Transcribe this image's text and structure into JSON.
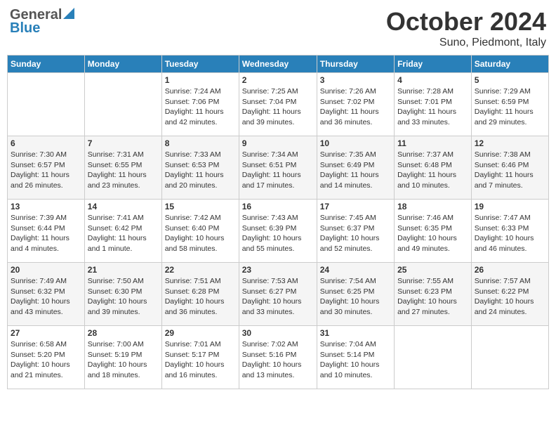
{
  "header": {
    "logo_general": "General",
    "logo_blue": "Blue",
    "title": "October 2024",
    "location": "Suno, Piedmont, Italy"
  },
  "weekdays": [
    "Sunday",
    "Monday",
    "Tuesday",
    "Wednesday",
    "Thursday",
    "Friday",
    "Saturday"
  ],
  "weeks": [
    [
      {
        "day": "",
        "sunrise": "",
        "sunset": "",
        "daylight": ""
      },
      {
        "day": "",
        "sunrise": "",
        "sunset": "",
        "daylight": ""
      },
      {
        "day": "1",
        "sunrise": "Sunrise: 7:24 AM",
        "sunset": "Sunset: 7:06 PM",
        "daylight": "Daylight: 11 hours and 42 minutes."
      },
      {
        "day": "2",
        "sunrise": "Sunrise: 7:25 AM",
        "sunset": "Sunset: 7:04 PM",
        "daylight": "Daylight: 11 hours and 39 minutes."
      },
      {
        "day": "3",
        "sunrise": "Sunrise: 7:26 AM",
        "sunset": "Sunset: 7:02 PM",
        "daylight": "Daylight: 11 hours and 36 minutes."
      },
      {
        "day": "4",
        "sunrise": "Sunrise: 7:28 AM",
        "sunset": "Sunset: 7:01 PM",
        "daylight": "Daylight: 11 hours and 33 minutes."
      },
      {
        "day": "5",
        "sunrise": "Sunrise: 7:29 AM",
        "sunset": "Sunset: 6:59 PM",
        "daylight": "Daylight: 11 hours and 29 minutes."
      }
    ],
    [
      {
        "day": "6",
        "sunrise": "Sunrise: 7:30 AM",
        "sunset": "Sunset: 6:57 PM",
        "daylight": "Daylight: 11 hours and 26 minutes."
      },
      {
        "day": "7",
        "sunrise": "Sunrise: 7:31 AM",
        "sunset": "Sunset: 6:55 PM",
        "daylight": "Daylight: 11 hours and 23 minutes."
      },
      {
        "day": "8",
        "sunrise": "Sunrise: 7:33 AM",
        "sunset": "Sunset: 6:53 PM",
        "daylight": "Daylight: 11 hours and 20 minutes."
      },
      {
        "day": "9",
        "sunrise": "Sunrise: 7:34 AM",
        "sunset": "Sunset: 6:51 PM",
        "daylight": "Daylight: 11 hours and 17 minutes."
      },
      {
        "day": "10",
        "sunrise": "Sunrise: 7:35 AM",
        "sunset": "Sunset: 6:49 PM",
        "daylight": "Daylight: 11 hours and 14 minutes."
      },
      {
        "day": "11",
        "sunrise": "Sunrise: 7:37 AM",
        "sunset": "Sunset: 6:48 PM",
        "daylight": "Daylight: 11 hours and 10 minutes."
      },
      {
        "day": "12",
        "sunrise": "Sunrise: 7:38 AM",
        "sunset": "Sunset: 6:46 PM",
        "daylight": "Daylight: 11 hours and 7 minutes."
      }
    ],
    [
      {
        "day": "13",
        "sunrise": "Sunrise: 7:39 AM",
        "sunset": "Sunset: 6:44 PM",
        "daylight": "Daylight: 11 hours and 4 minutes."
      },
      {
        "day": "14",
        "sunrise": "Sunrise: 7:41 AM",
        "sunset": "Sunset: 6:42 PM",
        "daylight": "Daylight: 11 hours and 1 minute."
      },
      {
        "day": "15",
        "sunrise": "Sunrise: 7:42 AM",
        "sunset": "Sunset: 6:40 PM",
        "daylight": "Daylight: 10 hours and 58 minutes."
      },
      {
        "day": "16",
        "sunrise": "Sunrise: 7:43 AM",
        "sunset": "Sunset: 6:39 PM",
        "daylight": "Daylight: 10 hours and 55 minutes."
      },
      {
        "day": "17",
        "sunrise": "Sunrise: 7:45 AM",
        "sunset": "Sunset: 6:37 PM",
        "daylight": "Daylight: 10 hours and 52 minutes."
      },
      {
        "day": "18",
        "sunrise": "Sunrise: 7:46 AM",
        "sunset": "Sunset: 6:35 PM",
        "daylight": "Daylight: 10 hours and 49 minutes."
      },
      {
        "day": "19",
        "sunrise": "Sunrise: 7:47 AM",
        "sunset": "Sunset: 6:33 PM",
        "daylight": "Daylight: 10 hours and 46 minutes."
      }
    ],
    [
      {
        "day": "20",
        "sunrise": "Sunrise: 7:49 AM",
        "sunset": "Sunset: 6:32 PM",
        "daylight": "Daylight: 10 hours and 43 minutes."
      },
      {
        "day": "21",
        "sunrise": "Sunrise: 7:50 AM",
        "sunset": "Sunset: 6:30 PM",
        "daylight": "Daylight: 10 hours and 39 minutes."
      },
      {
        "day": "22",
        "sunrise": "Sunrise: 7:51 AM",
        "sunset": "Sunset: 6:28 PM",
        "daylight": "Daylight: 10 hours and 36 minutes."
      },
      {
        "day": "23",
        "sunrise": "Sunrise: 7:53 AM",
        "sunset": "Sunset: 6:27 PM",
        "daylight": "Daylight: 10 hours and 33 minutes."
      },
      {
        "day": "24",
        "sunrise": "Sunrise: 7:54 AM",
        "sunset": "Sunset: 6:25 PM",
        "daylight": "Daylight: 10 hours and 30 minutes."
      },
      {
        "day": "25",
        "sunrise": "Sunrise: 7:55 AM",
        "sunset": "Sunset: 6:23 PM",
        "daylight": "Daylight: 10 hours and 27 minutes."
      },
      {
        "day": "26",
        "sunrise": "Sunrise: 7:57 AM",
        "sunset": "Sunset: 6:22 PM",
        "daylight": "Daylight: 10 hours and 24 minutes."
      }
    ],
    [
      {
        "day": "27",
        "sunrise": "Sunrise: 6:58 AM",
        "sunset": "Sunset: 5:20 PM",
        "daylight": "Daylight: 10 hours and 21 minutes."
      },
      {
        "day": "28",
        "sunrise": "Sunrise: 7:00 AM",
        "sunset": "Sunset: 5:19 PM",
        "daylight": "Daylight: 10 hours and 18 minutes."
      },
      {
        "day": "29",
        "sunrise": "Sunrise: 7:01 AM",
        "sunset": "Sunset: 5:17 PM",
        "daylight": "Daylight: 10 hours and 16 minutes."
      },
      {
        "day": "30",
        "sunrise": "Sunrise: 7:02 AM",
        "sunset": "Sunset: 5:16 PM",
        "daylight": "Daylight: 10 hours and 13 minutes."
      },
      {
        "day": "31",
        "sunrise": "Sunrise: 7:04 AM",
        "sunset": "Sunset: 5:14 PM",
        "daylight": "Daylight: 10 hours and 10 minutes."
      },
      {
        "day": "",
        "sunrise": "",
        "sunset": "",
        "daylight": ""
      },
      {
        "day": "",
        "sunrise": "",
        "sunset": "",
        "daylight": ""
      }
    ]
  ]
}
